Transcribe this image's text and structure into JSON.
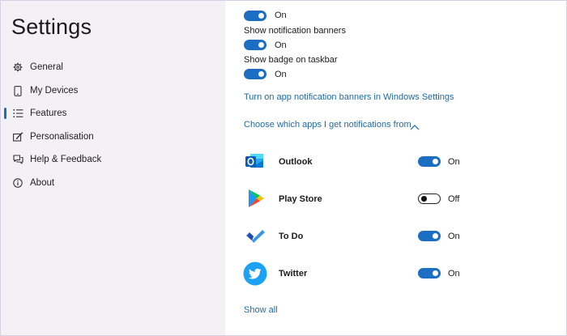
{
  "sidebar": {
    "title": "Settings",
    "items": [
      {
        "label": "General",
        "icon": "gear-icon"
      },
      {
        "label": "My Devices",
        "icon": "phone-icon"
      },
      {
        "label": "Features",
        "icon": "list-icon",
        "selected": true
      },
      {
        "label": "Personalisation",
        "icon": "brush-icon"
      },
      {
        "label": "Help & Feedback",
        "icon": "chat-icon"
      },
      {
        "label": "About",
        "icon": "info-icon"
      }
    ]
  },
  "main": {
    "top_toggle_state": "On",
    "banners_label": "Show notification banners",
    "banners_state": "On",
    "badge_label": "Show badge on taskbar",
    "badge_state": "On",
    "windows_link": "Turn on app notification banners in Windows Settings",
    "choose_apps": "Choose which apps I get notifications from",
    "apps": [
      {
        "name": "Outlook",
        "state": "On",
        "icon": "outlook-icon"
      },
      {
        "name": "Play Store",
        "state": "Off",
        "icon": "play-store-icon"
      },
      {
        "name": "To Do",
        "state": "On",
        "icon": "todo-icon"
      },
      {
        "name": "Twitter",
        "state": "On",
        "icon": "twitter-icon"
      }
    ],
    "show_all": "Show all"
  },
  "colors": {
    "accent": "#1b6ec2",
    "sidebar_bg": "#f3f1f6",
    "link": "#1e6aa8"
  }
}
